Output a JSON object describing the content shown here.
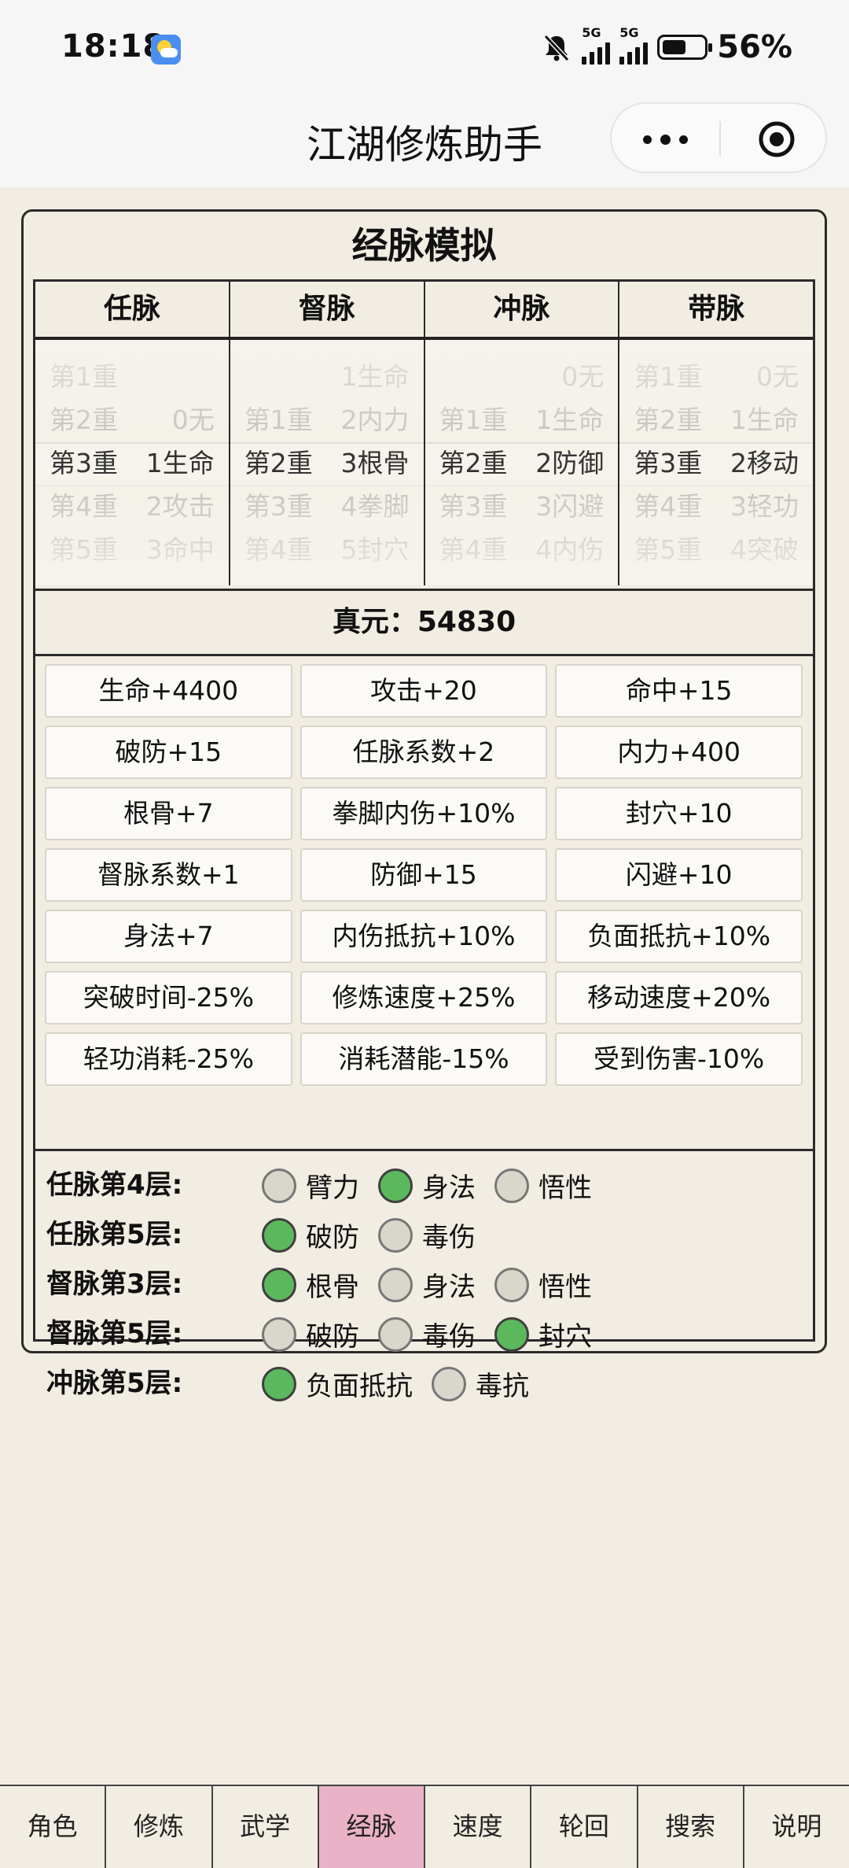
{
  "status_bar": {
    "time": "18:18",
    "network1": "5G",
    "network2": "5G",
    "battery_pct": "56%",
    "battery_level": 0.56,
    "icons": [
      "weather-icon",
      "mute-bell-icon",
      "signal-icon",
      "battery-icon"
    ]
  },
  "titlebar": {
    "title": "江湖修炼助手",
    "icons": [
      "more-dots-icon",
      "close-target-icon"
    ]
  },
  "panel": {
    "title": "经脉模拟",
    "columns": [
      {
        "name": "任脉",
        "levels": [
          "",
          "第1重",
          "第2重",
          "第3重",
          "第4重",
          "第5重"
        ],
        "values": [
          "",
          "",
          "0无",
          "1生命",
          "2攻击",
          "3命中"
        ],
        "selected_index": 3
      },
      {
        "name": "督脉",
        "levels": [
          "",
          "",
          "第1重",
          "第2重",
          "第3重",
          "第4重"
        ],
        "values": [
          "",
          "1生命",
          "2内力",
          "3根骨",
          "4拳脚",
          "5封穴"
        ],
        "selected_index": 3
      },
      {
        "name": "冲脉",
        "levels": [
          "",
          "",
          "第1重",
          "第2重",
          "第3重",
          "第4重"
        ],
        "values": [
          "",
          "0无",
          "1生命",
          "2防御",
          "3闪避",
          "4内伤"
        ],
        "selected_index": 3
      },
      {
        "name": "带脉",
        "levels": [
          "",
          "第1重",
          "第2重",
          "第3重",
          "第4重",
          "第5重"
        ],
        "values": [
          "",
          "0无",
          "1生命",
          "2移动",
          "3轻功",
          "4突破"
        ],
        "selected_index": 3
      }
    ],
    "zhenyuan": "真元：54830",
    "stats": [
      "生命+4400",
      "攻击+20",
      "命中+15",
      "破防+15",
      "任脉系数+2",
      "内力+400",
      "根骨+7",
      "拳脚内伤+10%",
      "封穴+10",
      "督脉系数+1",
      "防御+15",
      "闪避+10",
      "身法+7",
      "内伤抵抗+10%",
      "负面抵抗+10%",
      "突破时间-25%",
      "修炼速度+25%",
      "移动速度+20%",
      "轻功消耗-25%",
      "消耗潜能-15%",
      "受到伤害-10%"
    ],
    "choices": [
      {
        "label": "任脉第4层:",
        "options": [
          {
            "text": "臂力",
            "on": false
          },
          {
            "text": "身法",
            "on": true
          },
          {
            "text": "悟性",
            "on": false
          }
        ]
      },
      {
        "label": "任脉第5层:",
        "options": [
          {
            "text": "破防",
            "on": true
          },
          {
            "text": "毒伤",
            "on": false
          }
        ]
      },
      {
        "label": "督脉第3层:",
        "options": [
          {
            "text": "根骨",
            "on": true
          },
          {
            "text": "身法",
            "on": false
          },
          {
            "text": "悟性",
            "on": false
          }
        ]
      },
      {
        "label": "督脉第5层:",
        "options": [
          {
            "text": "破防",
            "on": false
          },
          {
            "text": "毒伤",
            "on": false
          },
          {
            "text": "封穴",
            "on": true
          }
        ]
      },
      {
        "label": "冲脉第5层:",
        "options": [
          {
            "text": "负面抵抗",
            "on": true
          },
          {
            "text": "毒抗",
            "on": false
          }
        ]
      }
    ],
    "colors": {
      "radio_on": "#5cb85c",
      "radio_off": "#d9d6cc",
      "nav_active": "#eab2c6",
      "background": "#f1ede2"
    }
  },
  "bottom_nav": {
    "items": [
      "角色",
      "修炼",
      "武学",
      "经脉",
      "速度",
      "轮回",
      "搜索",
      "说明"
    ],
    "active_index": 3
  }
}
